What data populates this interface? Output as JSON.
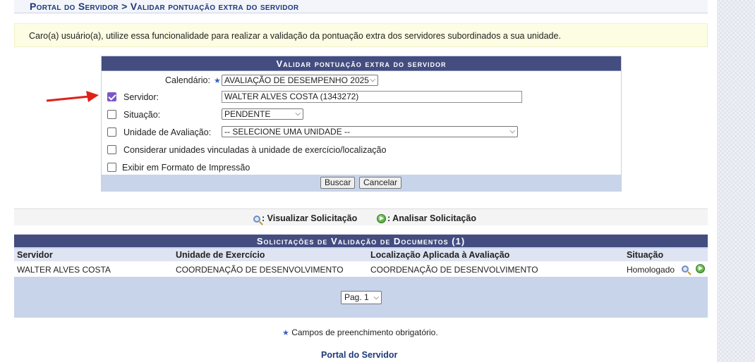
{
  "breadcrumb": "Portal do Servidor > Validar pontuação extra do servidor",
  "info_message": "Caro(a) usuário(a), utilize essa funcionalidade para realizar a validação da pontuação extra dos servidores subordinados a sua unidade.",
  "form": {
    "title": "Validar pontuação extra do servidor",
    "calendario_label": "Calendário:",
    "calendario_value": "AVALIAÇÃO DE DESEMPENHO 2025",
    "servidor_label": "Servidor:",
    "servidor_value": "WALTER ALVES COSTA (1343272)",
    "servidor_checked": true,
    "situacao_label": "Situação:",
    "situacao_value": "PENDENTE",
    "unidade_label": "Unidade de Avaliação:",
    "unidade_value": "-- SELECIONE UMA UNIDADE --",
    "considerar_label": "Considerar unidades vinculadas à unidade de exercício/localização",
    "exibir_label": "Exibir em Formato de Impressão",
    "buscar_label": "Buscar",
    "cancelar_label": "Cancelar"
  },
  "legend": {
    "visualizar": ": Visualizar Solicitação",
    "analisar": ": Analisar Solicitação"
  },
  "listing": {
    "title": "Solicitações de Validação de Documentos (1)",
    "headers": [
      "Servidor",
      "Unidade de Exercício",
      "Localização Aplicada à Avaliação",
      "Situação"
    ],
    "rows": [
      [
        "WALTER ALVES COSTA",
        "COORDENAÇÃO DE DESENVOLVIMENTO",
        "COORDENAÇÃO DE DESENVOLVIMENTO",
        "Homologado"
      ]
    ],
    "page_select": "Pag. 1"
  },
  "footnote": "Campos de preenchimento obrigatório.",
  "portal_link": "Portal do Servidor",
  "colors": {
    "caption_bg": "#434d80",
    "accent_blue": "#1d3a7a",
    "arrow_red": "#e0201a"
  },
  "icons": [
    "star-icon",
    "magnifier-icon",
    "go-arrow-icon",
    "chevron-down-icon",
    "red-arrow-annotation"
  ]
}
